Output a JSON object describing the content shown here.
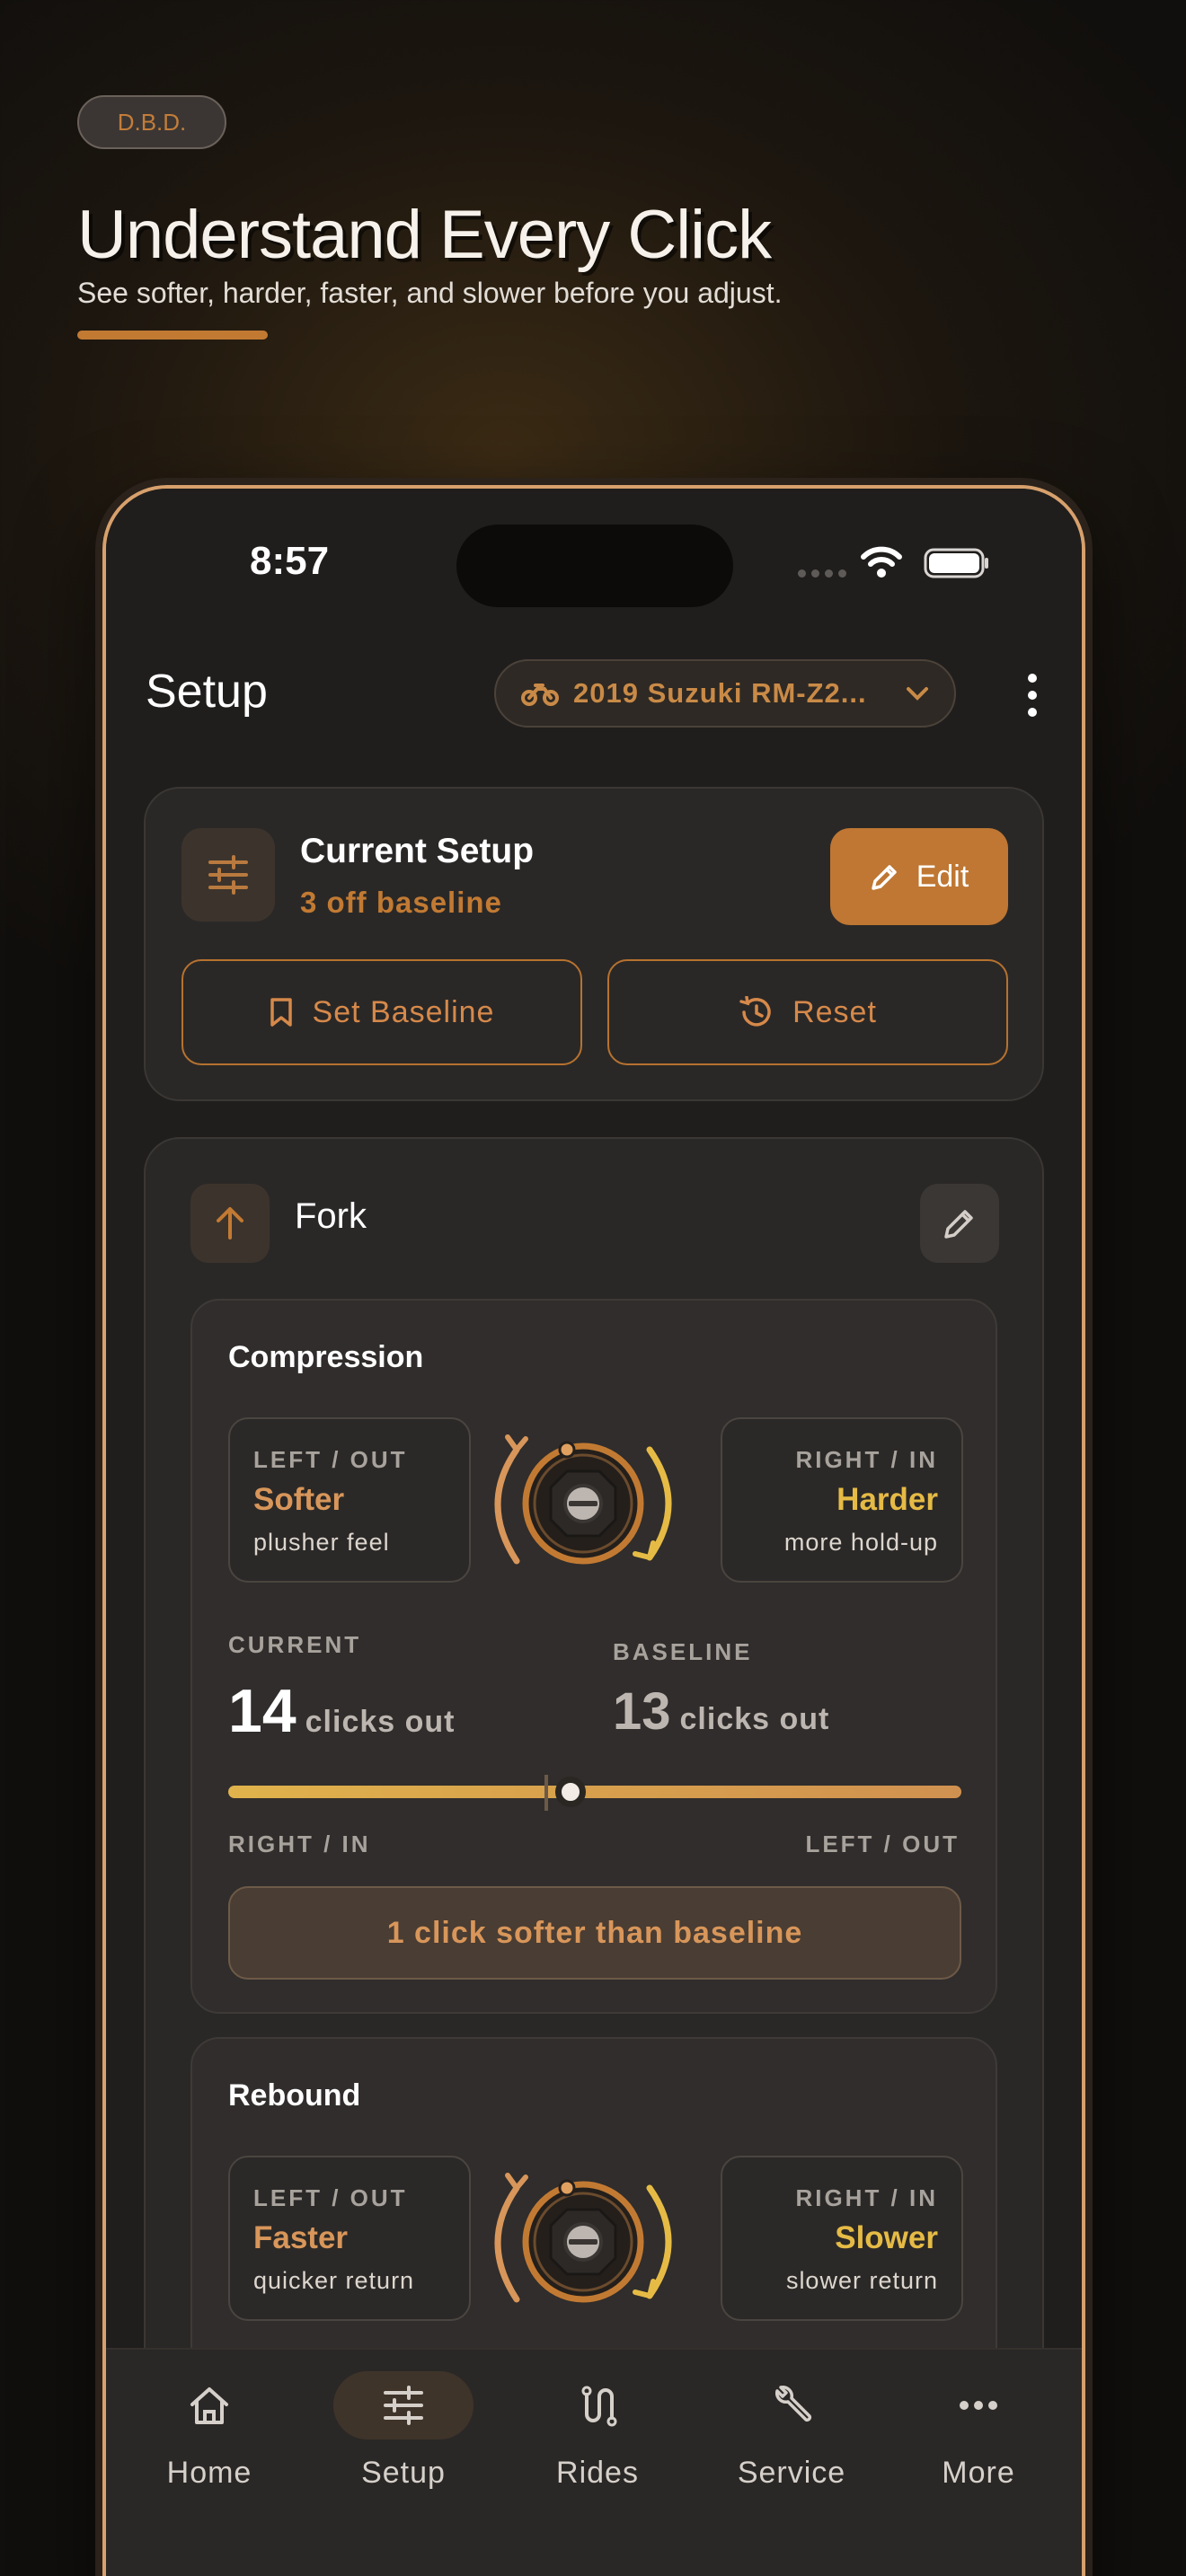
{
  "hero": {
    "badge": "D.B.D.",
    "title": "Understand Every Click",
    "subtitle": "See softer, harder, faster, and slower before you adjust."
  },
  "status": {
    "time": "8:57"
  },
  "header": {
    "title": "Setup",
    "bike": "2019 Suzuki RM-Z2..."
  },
  "current_setup": {
    "title": "Current Setup",
    "subtitle": "3 off baseline",
    "edit_label": "Edit",
    "baseline_label": "Set Baseline",
    "reset_label": "Reset"
  },
  "fork": {
    "title": "Fork",
    "compression": {
      "title": "Compression",
      "left_label": "LEFT / OUT",
      "left_value": "Softer",
      "left_note": "plusher feel",
      "right_label": "RIGHT / IN",
      "right_value": "Harder",
      "right_note": "more hold-up",
      "current_label": "CURRENT",
      "current_value": "14",
      "current_unit": "clicks out",
      "baseline_label": "BASELINE",
      "baseline_value": "13",
      "baseline_unit": "clicks out",
      "slider_left": "RIGHT / IN",
      "slider_right": "LEFT / OUT",
      "delta": "1 click softer than baseline"
    },
    "rebound": {
      "title": "Rebound",
      "left_label": "LEFT / OUT",
      "left_value": "Faster",
      "left_note": "quicker return",
      "right_label": "RIGHT / IN",
      "right_value": "Slower",
      "right_note": "slower return"
    }
  },
  "tabs": [
    {
      "label": "Home",
      "icon": "home-icon"
    },
    {
      "label": "Setup",
      "icon": "sliders-icon"
    },
    {
      "label": "Rides",
      "icon": "route-icon"
    },
    {
      "label": "Service",
      "icon": "wrench-icon"
    },
    {
      "label": "More",
      "icon": "more-icon"
    }
  ],
  "colors": {
    "accent": "#bf7733",
    "softer": "#d8965a",
    "harder": "#e6bb45"
  }
}
